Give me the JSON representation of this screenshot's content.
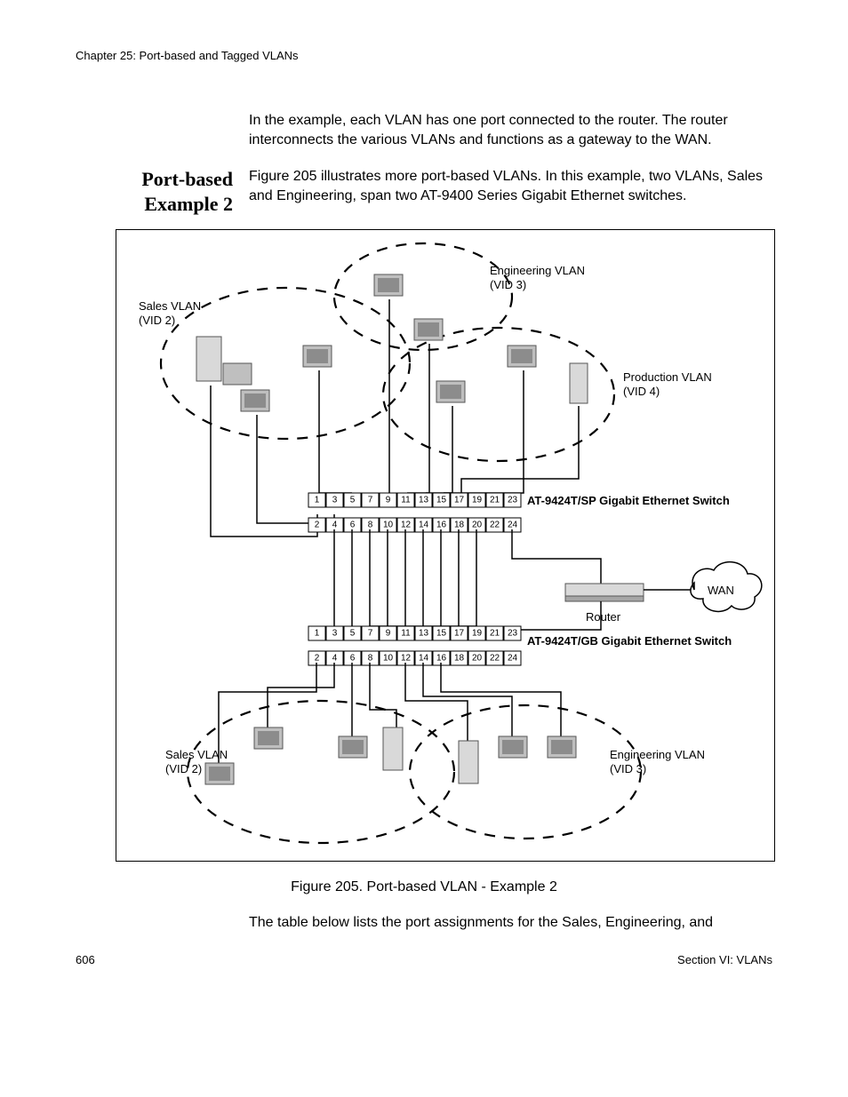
{
  "chapter": "Chapter 25: Port-based and Tagged VLANs",
  "intro": "In the example, each VLAN has one port connected to the router. The router interconnects the various VLANs and functions as a gateway to the WAN.",
  "section_heading_l1": "Port-based",
  "section_heading_l2": "Example 2",
  "section_body": "Figure 205 illustrates more port-based VLANs. In this example, two VLANs, Sales and Engineering, span two AT-9400 Series Gigabit Ethernet switches.",
  "fig": {
    "sales_vlan_top_l1": "Sales VLAN",
    "sales_vlan_top_l2": "(VID 2)",
    "eng_vlan_top_l1": "Engineering VLAN",
    "eng_vlan_top_l2": "(VID 3)",
    "prod_vlan_l1": "Production VLAN",
    "prod_vlan_l2": "(VID 4)",
    "sales_vlan_bot_l1": "Sales VLAN",
    "sales_vlan_bot_l2": "(VID 2)",
    "eng_vlan_bot_l1": "Engineering VLAN",
    "eng_vlan_bot_l2": "(VID 3)",
    "switch_top": "AT-9424T/SP Gigabit Ethernet Switch",
    "switch_bot": "AT-9424T/GB Gigabit Ethernet Switch",
    "router": "Router",
    "wan": "WAN",
    "ports_odd": [
      "1",
      "3",
      "5",
      "7",
      "9",
      "11",
      "13",
      "15",
      "17",
      "19",
      "21",
      "23"
    ],
    "ports_even": [
      "2",
      "4",
      "6",
      "8",
      "10",
      "12",
      "14",
      "16",
      "18",
      "20",
      "22",
      "24"
    ]
  },
  "caption": "Figure 205. Port-based VLAN - Example 2",
  "follow": "The table below lists the port assignments for the Sales, Engineering, and",
  "page_num": "606",
  "section_footer": "Section VI: VLANs"
}
